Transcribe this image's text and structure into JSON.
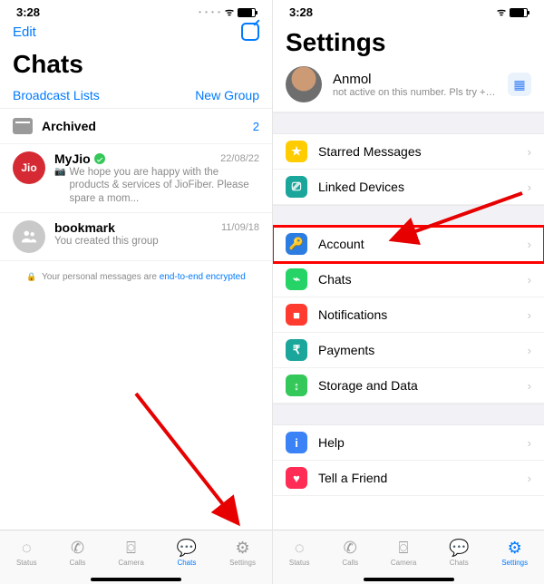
{
  "status": {
    "time": "3:28"
  },
  "chats_screen": {
    "edit": "Edit",
    "title": "Chats",
    "broadcast": "Broadcast Lists",
    "new_group": "New Group",
    "archived": {
      "label": "Archived",
      "count": "2"
    },
    "items": [
      {
        "name": "MyJio",
        "time": "22/08/22",
        "preview": "We hope you are happy with the products & services of JioFiber. Please spare a mom...",
        "avatar_text": "Jio",
        "verified": true
      },
      {
        "name": "bookmark",
        "time": "11/09/18",
        "preview": "You created this group"
      }
    ],
    "enc_text": "Your personal messages are ",
    "enc_link": "end-to-end encrypted"
  },
  "settings_screen": {
    "title": "Settings",
    "profile": {
      "name": "Anmol",
      "status": "not active on this number. Pls try +9..."
    },
    "group1": [
      {
        "icon": "star",
        "glyph": "★",
        "label": "Starred Messages"
      },
      {
        "icon": "link",
        "glyph": "⎚",
        "label": "Linked Devices"
      }
    ],
    "group2": [
      {
        "icon": "key",
        "glyph": "🔑",
        "label": "Account",
        "highlight": true
      },
      {
        "icon": "chats",
        "glyph": "⌁",
        "label": "Chats"
      },
      {
        "icon": "notif",
        "glyph": "■",
        "label": "Notifications"
      },
      {
        "icon": "pay",
        "glyph": "₹",
        "label": "Payments"
      },
      {
        "icon": "storage",
        "glyph": "↕",
        "label": "Storage and Data"
      }
    ],
    "group3": [
      {
        "icon": "help",
        "glyph": "i",
        "label": "Help"
      },
      {
        "icon": "heart",
        "glyph": "♥",
        "label": "Tell a Friend"
      }
    ]
  },
  "tabs": {
    "status": "Status",
    "calls": "Calls",
    "camera": "Camera",
    "chats": "Chats",
    "settings": "Settings"
  }
}
